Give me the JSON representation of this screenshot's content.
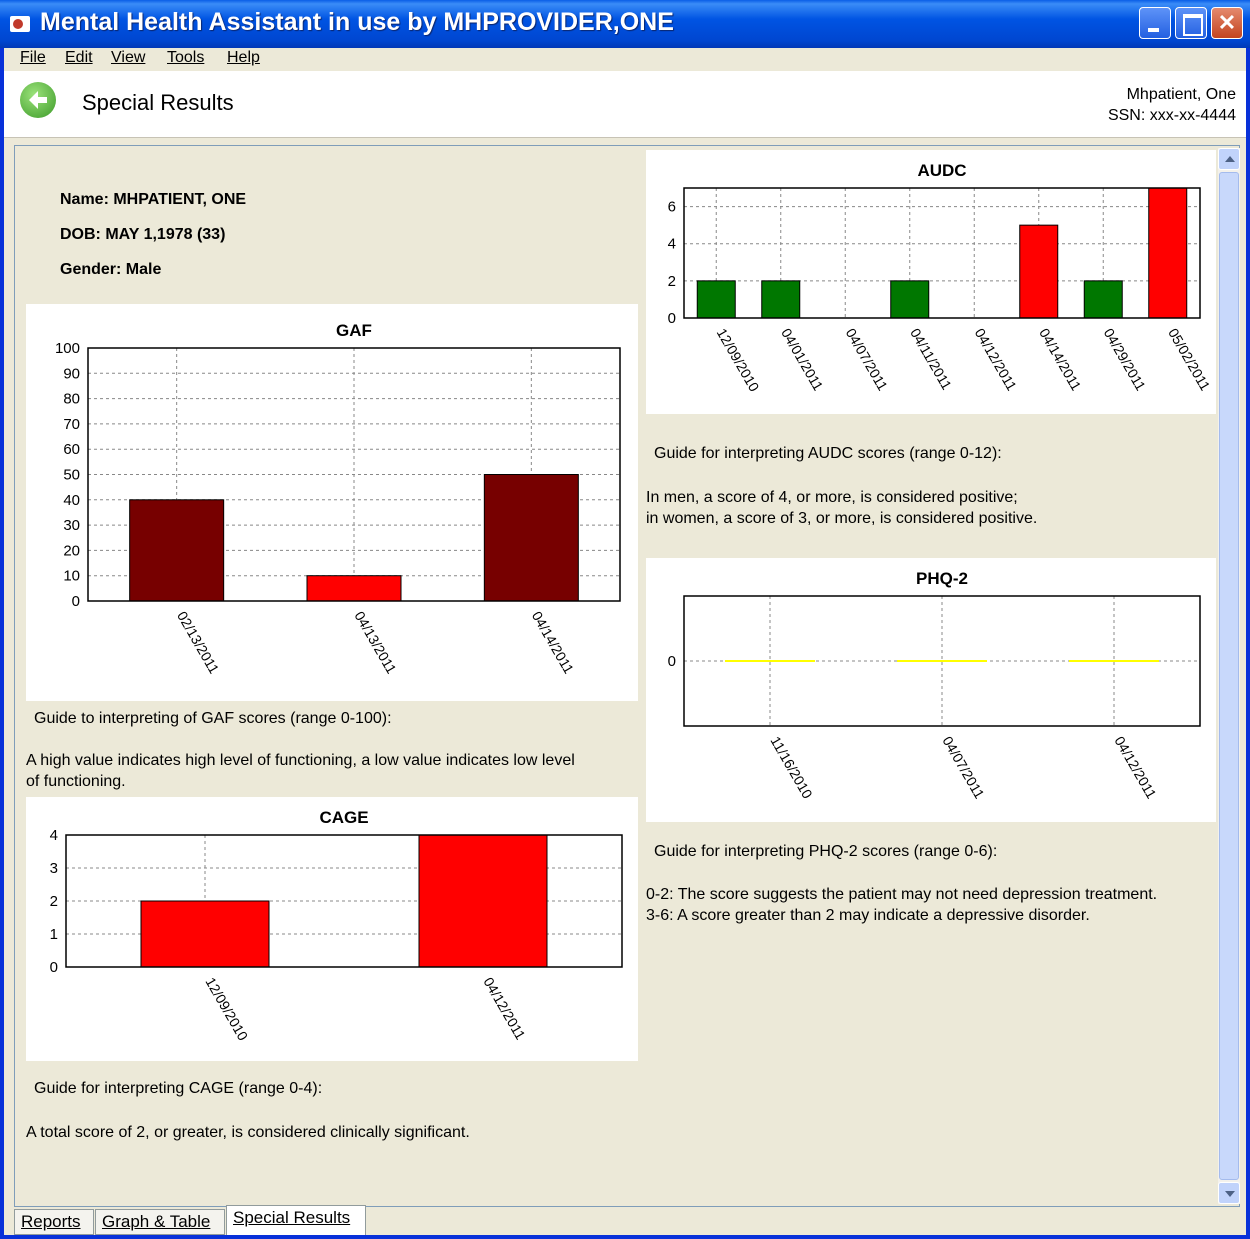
{
  "window": {
    "title": "Mental Health Assistant in use by MHPROVIDER,ONE"
  },
  "menu": [
    "File",
    "Edit",
    "View",
    "Tools",
    "Help"
  ],
  "toolbar": {
    "title": "Special Results",
    "patient_name": "Mhpatient, One",
    "ssn": "SSN: xxx-xx-4444"
  },
  "patient": {
    "name": "Name: MHPATIENT, ONE",
    "dob": "DOB: MAY 1,1978  (33)",
    "gender": "Gender: Male"
  },
  "guides": {
    "gaf_title": "Guide to interpreting of GAF scores (range 0-100):",
    "gaf_text_1": "A high value indicates high level of functioning, a low value indicates low level",
    "gaf_text_2": "of functioning.",
    "cage_title": "Guide for interpreting CAGE (range 0-4):",
    "cage_text": "A total score of 2, or greater, is considered clinically significant.",
    "audc_title": "Guide for interpreting AUDC scores (range 0-12):",
    "audc_text_1": "In men, a score of 4, or more, is considered positive;",
    "audc_text_2": "in women, a score of 3, or more, is considered positive.",
    "phq_title": "Guide for interpreting PHQ-2 scores (range 0-6):",
    "phq_text_1": "0-2: The score suggests the patient may not need depression treatment.",
    "phq_text_2": "3-6: A score greater than 2 may indicate a depressive disorder."
  },
  "tabs": [
    "Reports",
    "Graph & Table",
    "Special Results"
  ],
  "chart_data": [
    {
      "type": "bar",
      "title": "GAF",
      "categories": [
        "02/13/2011",
        "04/13/2011",
        "04/14/2011"
      ],
      "values": [
        40,
        10,
        50
      ],
      "colors": [
        "#770000",
        "#ff0000",
        "#770000"
      ],
      "ylim": [
        0,
        100
      ],
      "yticks": [
        0,
        10,
        20,
        30,
        40,
        50,
        60,
        70,
        80,
        90,
        100
      ],
      "grid": true
    },
    {
      "type": "bar",
      "title": "CAGE",
      "categories": [
        "12/09/2010",
        "04/12/2011"
      ],
      "values": [
        2,
        4
      ],
      "colors": [
        "#ff0000",
        "#ff0000"
      ],
      "ylim": [
        0,
        4
      ],
      "yticks": [
        0,
        1,
        2,
        3,
        4
      ],
      "grid": true
    },
    {
      "type": "bar",
      "title": "AUDC",
      "categories": [
        "12/09/2010",
        "04/01/2011",
        "04/07/2011",
        "04/11/2011",
        "04/12/2011",
        "04/14/2011",
        "04/29/2011",
        "05/02/2011"
      ],
      "values": [
        2,
        2,
        0,
        2,
        0,
        5,
        2,
        7
      ],
      "colors": [
        "#007700",
        "#007700",
        "#007700",
        "#007700",
        "#007700",
        "#ff0000",
        "#007700",
        "#ff0000"
      ],
      "ylim": [
        0,
        7
      ],
      "yticks": [
        0,
        2,
        4,
        6
      ],
      "grid": true
    },
    {
      "type": "bar",
      "title": "PHQ-2",
      "categories": [
        "11/16/2010",
        "04/07/2011",
        "04/12/2011"
      ],
      "values": [
        0,
        0,
        0
      ],
      "colors": [
        "#ffff00",
        "#ffff00",
        "#ffff00"
      ],
      "ylim": [
        -1,
        1
      ],
      "yticks": [
        0
      ],
      "grid": true
    }
  ]
}
